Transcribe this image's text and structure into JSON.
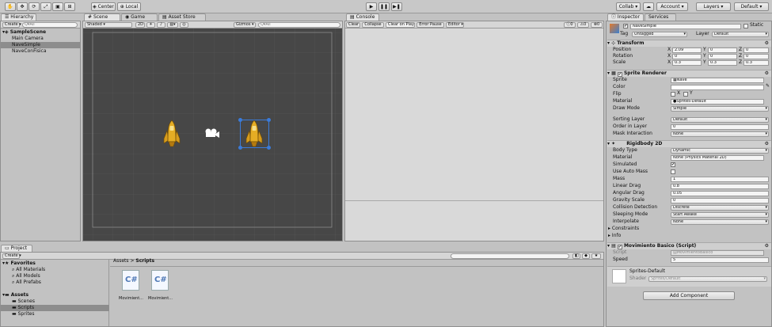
{
  "toolbar": {
    "transform_tools": [
      "hand",
      "move",
      "rotate",
      "scale",
      "rect",
      "transform"
    ],
    "pivot_label": "Center",
    "space_label": "Local",
    "collab_label": "Collab",
    "account_label": "Account",
    "layers_label": "Layers",
    "layout_label": "Default"
  },
  "hierarchy": {
    "tab": "Hierarchy",
    "create": "Create",
    "search_placeholder": "Q▾All",
    "scene": "SampleScene",
    "items": [
      "Main Camera",
      "NaveSimple",
      "NaveConFisica"
    ]
  },
  "scene_view": {
    "tabs": [
      "Scene",
      "Game",
      "Asset Store"
    ],
    "shading": "Shaded",
    "mode_2d": "2D",
    "gizmos": "Gizmos",
    "search_placeholder": "Q▾All"
  },
  "console": {
    "tab": "Console",
    "buttons": [
      "Clear",
      "Collapse",
      "Clear on Play",
      "Error Pause",
      "Editor"
    ],
    "counts": [
      "0",
      "0",
      "0"
    ]
  },
  "inspector": {
    "tabs": [
      "Inspector",
      "Services"
    ],
    "object_name": "NaveSimple",
    "static_label": "Static",
    "tag_label": "Tag",
    "tag_value": "Untagged",
    "layer_label": "Layer",
    "layer_value": "Default",
    "transform": {
      "title": "Transform",
      "position_label": "Position",
      "rotation_label": "Rotation",
      "scale_label": "Scale",
      "position": {
        "x": "2.09",
        "y": "0",
        "z": "0"
      },
      "rotation": {
        "x": "0",
        "y": "0",
        "z": "0"
      },
      "scale": {
        "x": "0.3",
        "y": "0.3",
        "z": "0.3"
      },
      "axis": {
        "x": "X",
        "y": "Y",
        "z": "Z"
      }
    },
    "sprite_renderer": {
      "title": "Sprite Renderer",
      "sprite_label": "Sprite",
      "sprite_value": "Nave",
      "color_label": "Color",
      "flip_label": "Flip",
      "flip_x": "X",
      "flip_y": "Y",
      "material_label": "Material",
      "material_value": "Sprites-Default",
      "draw_mode_label": "Draw Mode",
      "draw_mode_value": "Simple",
      "sorting_layer_label": "Sorting Layer",
      "sorting_layer_value": "Default",
      "order_label": "Order in Layer",
      "order_value": "0",
      "mask_label": "Mask Interaction",
      "mask_value": "None"
    },
    "rigidbody": {
      "title": "Rigidbody 2D",
      "body_type_label": "Body Type",
      "body_type_value": "Dynamic",
      "material_label": "Material",
      "material_value": "None (Physics Material 2D)",
      "simulated_label": "Simulated",
      "auto_mass_label": "Use Auto Mass",
      "mass_label": "Mass",
      "mass_value": "1",
      "linear_drag_label": "Linear Drag",
      "linear_drag_value": "0.8",
      "angular_drag_label": "Angular Drag",
      "angular_drag_value": "0.05",
      "gravity_label": "Gravity Scale",
      "gravity_value": "0",
      "collision_label": "Collision Detection",
      "collision_value": "Discrete",
      "sleeping_label": "Sleeping Mode",
      "sleeping_value": "Start Awake",
      "interpolate_label": "Interpolate",
      "interpolate_value": "None",
      "constraints_label": "Constraints",
      "info_label": "Info"
    },
    "script_component": {
      "title": "Movimiento Basico (Script)",
      "script_label": "Script",
      "script_value": "MovimientoBasico",
      "speed_label": "Speed",
      "speed_value": "5"
    },
    "material_preview": {
      "name": "Sprites-Default",
      "shader_label": "Shader",
      "shader_value": "Sprites/Default"
    },
    "add_component": "Add Component"
  },
  "project": {
    "tab": "Project",
    "create": "Create",
    "favorites_label": "Favorites",
    "favorites": [
      "All Materials",
      "All Models",
      "All Prefabs"
    ],
    "assets_label": "Assets",
    "folders": [
      "Scenes",
      "Scripts",
      "Sprites"
    ],
    "breadcrumb_root": "Assets",
    "breadcrumb_sep": ">",
    "breadcrumb_current": "Scripts",
    "files": [
      {
        "icon": "C#",
        "name": "Movimient..."
      },
      {
        "icon": "C#",
        "name": "Movimient..."
      }
    ]
  }
}
